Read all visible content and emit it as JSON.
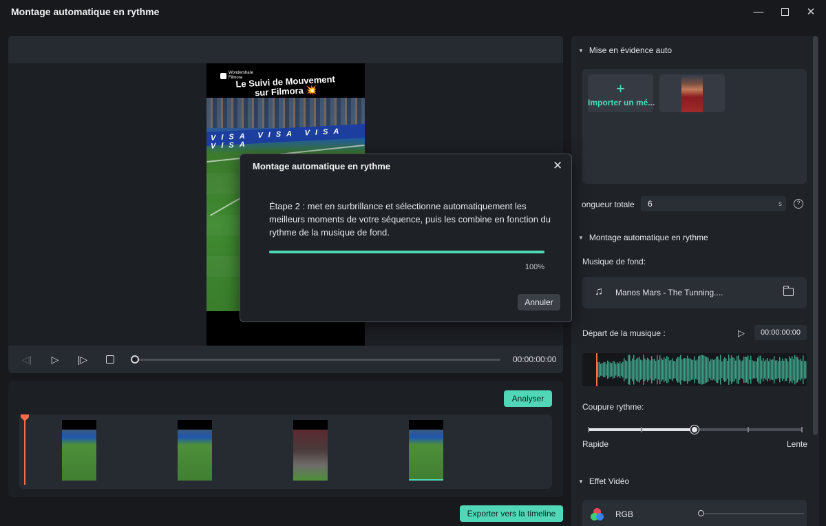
{
  "window": {
    "title": "Montage automatique en rythme",
    "controls": {
      "minimize": "—",
      "close": "✕"
    }
  },
  "preview": {
    "video": {
      "brand": "Wondershare\nFilmora",
      "caption_line1": "Le Suivi de Mouvement",
      "caption_line2": "sur Filmora",
      "caption_emoji": "💥",
      "board_text": "VISA VISA VISA VISA"
    },
    "playback": {
      "time": "00:00:00:00",
      "icons": [
        "prev-frame-icon",
        "play-icon",
        "next-frame-icon",
        "stop-icon"
      ]
    }
  },
  "clips": {
    "analyze_label": "Analyser",
    "export_label": "Exporter vers la timeline",
    "items": [
      {
        "name": "clip-1"
      },
      {
        "name": "clip-2"
      },
      {
        "name": "clip-3"
      },
      {
        "name": "clip-4",
        "selected": true
      }
    ]
  },
  "right_panel": {
    "highlight_section": "Mise en évidence auto",
    "import_label": "Importer un mé...",
    "duration_label": "ongueur totale",
    "duration_value": "6",
    "duration_unit": "s",
    "beat_section": "Montage automatique en rythme",
    "music_label": "Musique de fond:",
    "music_name": "Manos Mars - The Tunning....",
    "music_start_label": "Départ de la musique :",
    "music_start_time": "00:00:00:00",
    "rhythm_label": "Coupure rythme:",
    "rhythm_min": "Rapide",
    "rhythm_max": "Lente",
    "rhythm_level": 0.5,
    "effect_section": "Effet Vidéo",
    "effect_name": "RGB",
    "effect_level": 0.0
  },
  "dialog": {
    "title": "Montage automatique en rythme",
    "message": "Étape 2 : met en surbrillance et sélectionne automatiquement les meilleurs moments de votre séquence, puis les combine en fonction du rythme de la musique de fond.",
    "progress": 100,
    "progress_text": "100%",
    "cancel_label": "Annuler"
  },
  "colors": {
    "accent": "#51d7b8",
    "playhead": "#ff6e48",
    "background": "#17191d",
    "panel": "#1f2227"
  }
}
